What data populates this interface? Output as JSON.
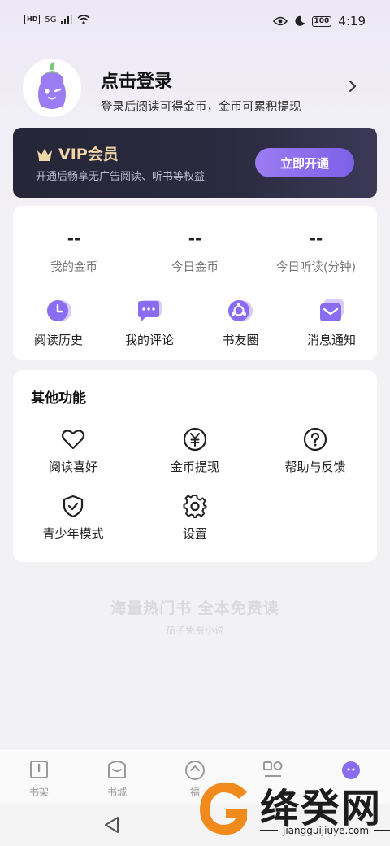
{
  "status_bar": {
    "hd": "HD",
    "network": "5G",
    "battery": "100",
    "time": "4:19"
  },
  "profile": {
    "title": "点击登录",
    "subtitle": "登录后阅读可得金币，金币可累积提现"
  },
  "vip": {
    "title": "VIP会员",
    "subtitle": "开通后畅享无广告阅读、听书等权益",
    "button": "立即开通"
  },
  "stats": [
    {
      "value": "--",
      "label": "我的金币"
    },
    {
      "value": "--",
      "label": "今日金币"
    },
    {
      "value": "--",
      "label": "今日听读(分钟)"
    }
  ],
  "quick_actions": [
    {
      "label": "阅读历史",
      "icon": "clock-icon"
    },
    {
      "label": "我的评论",
      "icon": "comment-icon"
    },
    {
      "label": "书友圈",
      "icon": "circle-icon"
    },
    {
      "label": "消息通知",
      "icon": "mail-icon"
    }
  ],
  "other": {
    "title": "其他功能",
    "items": [
      {
        "label": "阅读喜好",
        "icon": "heart-icon"
      },
      {
        "label": "金币提现",
        "icon": "yen-icon"
      },
      {
        "label": "帮助与反馈",
        "icon": "help-icon"
      },
      {
        "label": "青少年模式",
        "icon": "shield-icon"
      },
      {
        "label": "设置",
        "icon": "gear-icon"
      }
    ]
  },
  "slogan": {
    "main": "海量热门书 全本免费读",
    "sub": "茄子免费小说"
  },
  "bottom_nav": [
    {
      "label": "书架",
      "icon": "bookshelf-icon"
    },
    {
      "label": "书城",
      "icon": "bookstore-icon"
    },
    {
      "label": "福",
      "icon": "welfare-icon"
    },
    {
      "label": "",
      "icon": "category-icon"
    },
    {
      "label": "",
      "icon": "mine-icon"
    }
  ],
  "watermark": {
    "text": "绛癸网",
    "url": "jiangguijiuye.com"
  },
  "colors": {
    "accent": "#8a6cf0",
    "vip_gold": "#f1d6a8",
    "vip_bg": "#262638"
  }
}
